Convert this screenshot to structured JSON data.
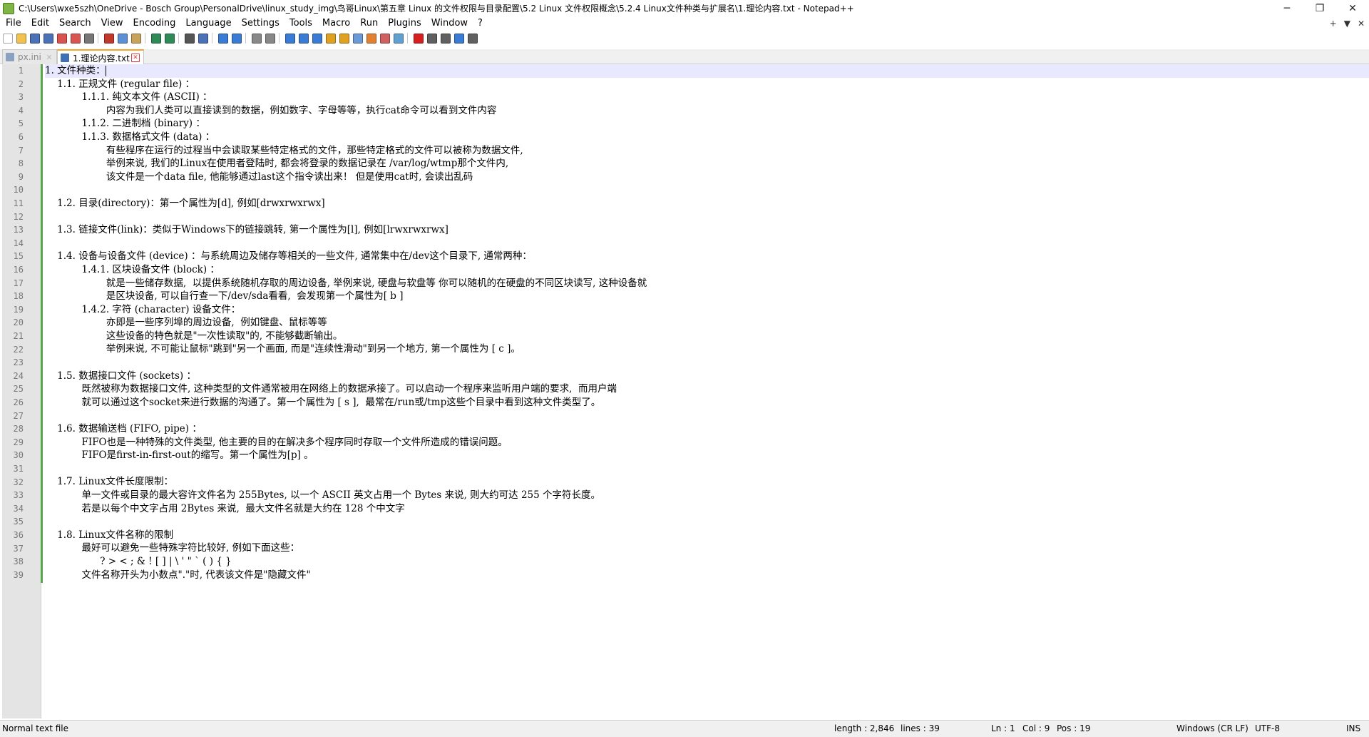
{
  "window": {
    "title": "C:\\Users\\wxe5szh\\OneDrive - Bosch Group\\PersonalDrive\\linux_study_img\\鸟哥Linux\\第五章 Linux 的文件权限与目录配置\\5.2 Linux 文件权限概念\\5.2.4 Linux文件种类与扩展名\\1.理论内容.txt - Notepad++",
    "minimize": "─",
    "maximize": "❐",
    "close": "✕"
  },
  "menu": {
    "items": [
      "File",
      "Edit",
      "Search",
      "View",
      "Encoding",
      "Language",
      "Settings",
      "Tools",
      "Macro",
      "Run",
      "Plugins",
      "Window",
      "?"
    ],
    "right": [
      "+",
      "▼",
      "✕"
    ]
  },
  "toolbar": {
    "icons": [
      {
        "name": "new-file-icon",
        "color": "#ffffff"
      },
      {
        "name": "open-file-icon",
        "color": "#f2c14e"
      },
      {
        "name": "save-icon",
        "color": "#4a72b8"
      },
      {
        "name": "save-all-icon",
        "color": "#4a72b8"
      },
      {
        "name": "close-icon",
        "color": "#d9534f"
      },
      {
        "name": "close-all-icon",
        "color": "#d9534f"
      },
      {
        "name": "print-icon",
        "color": "#777777"
      },
      {
        "sep": true
      },
      {
        "name": "cut-icon",
        "color": "#c0392b"
      },
      {
        "name": "copy-icon",
        "color": "#5b8fd6"
      },
      {
        "name": "paste-icon",
        "color": "#c8a45a"
      },
      {
        "sep": true
      },
      {
        "name": "undo-icon",
        "color": "#2e8b57"
      },
      {
        "name": "redo-icon",
        "color": "#2e8b57"
      },
      {
        "sep": true
      },
      {
        "name": "find-icon",
        "color": "#555555"
      },
      {
        "name": "replace-icon",
        "color": "#4a72b8"
      },
      {
        "sep": true
      },
      {
        "name": "zoom-in-icon",
        "color": "#3a7bd5"
      },
      {
        "name": "zoom-out-icon",
        "color": "#3a7bd5"
      },
      {
        "sep": true
      },
      {
        "name": "sync-vertical-icon",
        "color": "#888888"
      },
      {
        "name": "sync-horizontal-icon",
        "color": "#888888"
      },
      {
        "sep": true
      },
      {
        "name": "word-wrap-icon",
        "color": "#3a7bd5"
      },
      {
        "name": "show-all-chars-icon",
        "color": "#3a7bd5"
      },
      {
        "name": "indent-guide-icon",
        "color": "#3a7bd5"
      },
      {
        "name": "language-define-icon",
        "color": "#e0a020"
      },
      {
        "name": "doc-map-icon",
        "color": "#e0a020"
      },
      {
        "name": "function-list-icon",
        "color": "#6a9bd8"
      },
      {
        "name": "folder-as-workspace-icon",
        "color": "#e08030"
      },
      {
        "name": "doc-list-icon",
        "color": "#d06060"
      },
      {
        "name": "monitoring-icon",
        "color": "#60a0d0"
      },
      {
        "sep": true
      },
      {
        "name": "record-macro-icon",
        "color": "#d62020"
      },
      {
        "name": "stop-macro-icon",
        "color": "#606060"
      },
      {
        "name": "play-macro-icon",
        "color": "#606060"
      },
      {
        "name": "run-macro-multiple-icon",
        "color": "#3a7bd5"
      },
      {
        "name": "save-macro-icon",
        "color": "#606060"
      }
    ]
  },
  "tabs": [
    {
      "label": "px.ini",
      "active": false,
      "close": "✕"
    },
    {
      "label": "1.理论内容.txt",
      "active": true,
      "close": "✕"
    }
  ],
  "editor": {
    "lines": [
      "1. 文件种类：",
      "    1.1. 正规文件 (regular file) ：",
      "            1.1.1. 纯文本文件 (ASCII) ：",
      "                    内容为我们人类可以直接读到的数据，例如数字、字母等等，执行cat命令可以看到文件内容",
      "            1.1.2. 二进制档 (binary) ：",
      "            1.1.3. 数据格式文件 (data) ：",
      "                    有些程序在运行的过程当中会读取某些特定格式的文件，那些特定格式的文件可以被称为数据文件,",
      "                    举例来说, 我们的Linux在使用者登陆时, 都会将登录的数据记录在 /var/log/wtmp那个文件内,",
      "                    该文件是一个data file, 他能够通过last这个指令读出来！ 但是使用cat时, 会读出乱码",
      "",
      "    1.2. 目录(directory)：第一个属性为[d], 例如[drwxrwxrwx]",
      "",
      "    1.3. 链接文件(link)：类似于Windows下的链接跳转, 第一个属性为[l], 例如[lrwxrwxrwx]",
      "",
      "    1.4. 设备与设备文件 (device) ：与系统周边及储存等相关的一些文件, 通常集中在/dev这个目录下, 通常两种：",
      "            1.4.1. 区块设备文件 (block) ：",
      "                    就是一些储存数据,  以提供系统随机存取的周边设备, 举例来说, 硬盘与软盘等 你可以随机的在硬盘的不同区块读写, 这种设备就",
      "                    是区块设备, 可以自行查一下/dev/sda看看,  会发现第一个属性为[ b ]",
      "            1.4.2. 字符 (character) 设备文件：",
      "                    亦即是一些序列埠的周边设备,  例如键盘、鼠标等等",
      "                    这些设备的特色就是\"一次性读取\"的, 不能够截断输出。",
      "                    举例来说, 不可能让鼠标\"跳到\"另一个画面, 而是\"连续性滑动\"到另一个地方, 第一个属性为 [ c ]。",
      "",
      "    1.5. 数据接口文件 (sockets) ：",
      "            既然被称为数据接口文件, 这种类型的文件通常被用在网络上的数据承接了。可以启动一个程序来监听用户端的要求,  而用户端",
      "            就可以通过这个socket来进行数据的沟通了。第一个属性为 [ s ],  最常在/run或/tmp这些个目录中看到这种文件类型了。",
      "",
      "    1.6. 数据输送档 (FIFO, pipe) ：",
      "            FIFO也是一种特殊的文件类型, 他主要的目的在解决多个程序同时存取一个文件所造成的错误问题。",
      "            FIFO是first-in-first-out的缩写。第一个属性为[p] 。",
      "",
      "    1.7. Linux文件长度限制：",
      "            单一文件或目录的最大容许文件名为 255Bytes, 以一个 ASCII 英文占用一个 Bytes 来说, 则大约可达 255 个字符长度。",
      "            若是以每个中文字占用 2Bytes 来说,  最大文件名就是大约在 128 个中文字",
      "",
      "    1.8. Linux文件名称的限制",
      "            最好可以避免一些特殊字符比较好, 例如下面这些：",
      "                  ? > < ; & ! [ ] | \\ ' \" ` ( ) { }",
      "            文件名称开头为小数点\".\"时, 代表该文件是\"隐藏文件\""
    ],
    "line_numbers": [
      "1",
      "2",
      "3",
      "4",
      "5",
      "6",
      "7",
      "8",
      "9",
      "10",
      "11",
      "12",
      "13",
      "14",
      "15",
      "16",
      "17",
      "18",
      "19",
      "20",
      "21",
      "22",
      "23",
      "24",
      "25",
      "26",
      "27",
      "28",
      "29",
      "30",
      "31",
      "32",
      "33",
      "34",
      "35",
      "36",
      "37",
      "38",
      "39"
    ],
    "active_line": 1,
    "colors": {
      "fold_bar": "#57a64a",
      "active_line_bg": "#e8e8ff",
      "tab_accent": "#f6a623"
    }
  },
  "status": {
    "file_type": "Normal text file",
    "length": "length : 2,846",
    "lines": "lines : 39",
    "ln": "Ln : 1",
    "col": "Col : 9",
    "pos": "Pos : 19",
    "eol": "Windows (CR LF)",
    "encoding": "UTF-8",
    "mode": "INS"
  }
}
